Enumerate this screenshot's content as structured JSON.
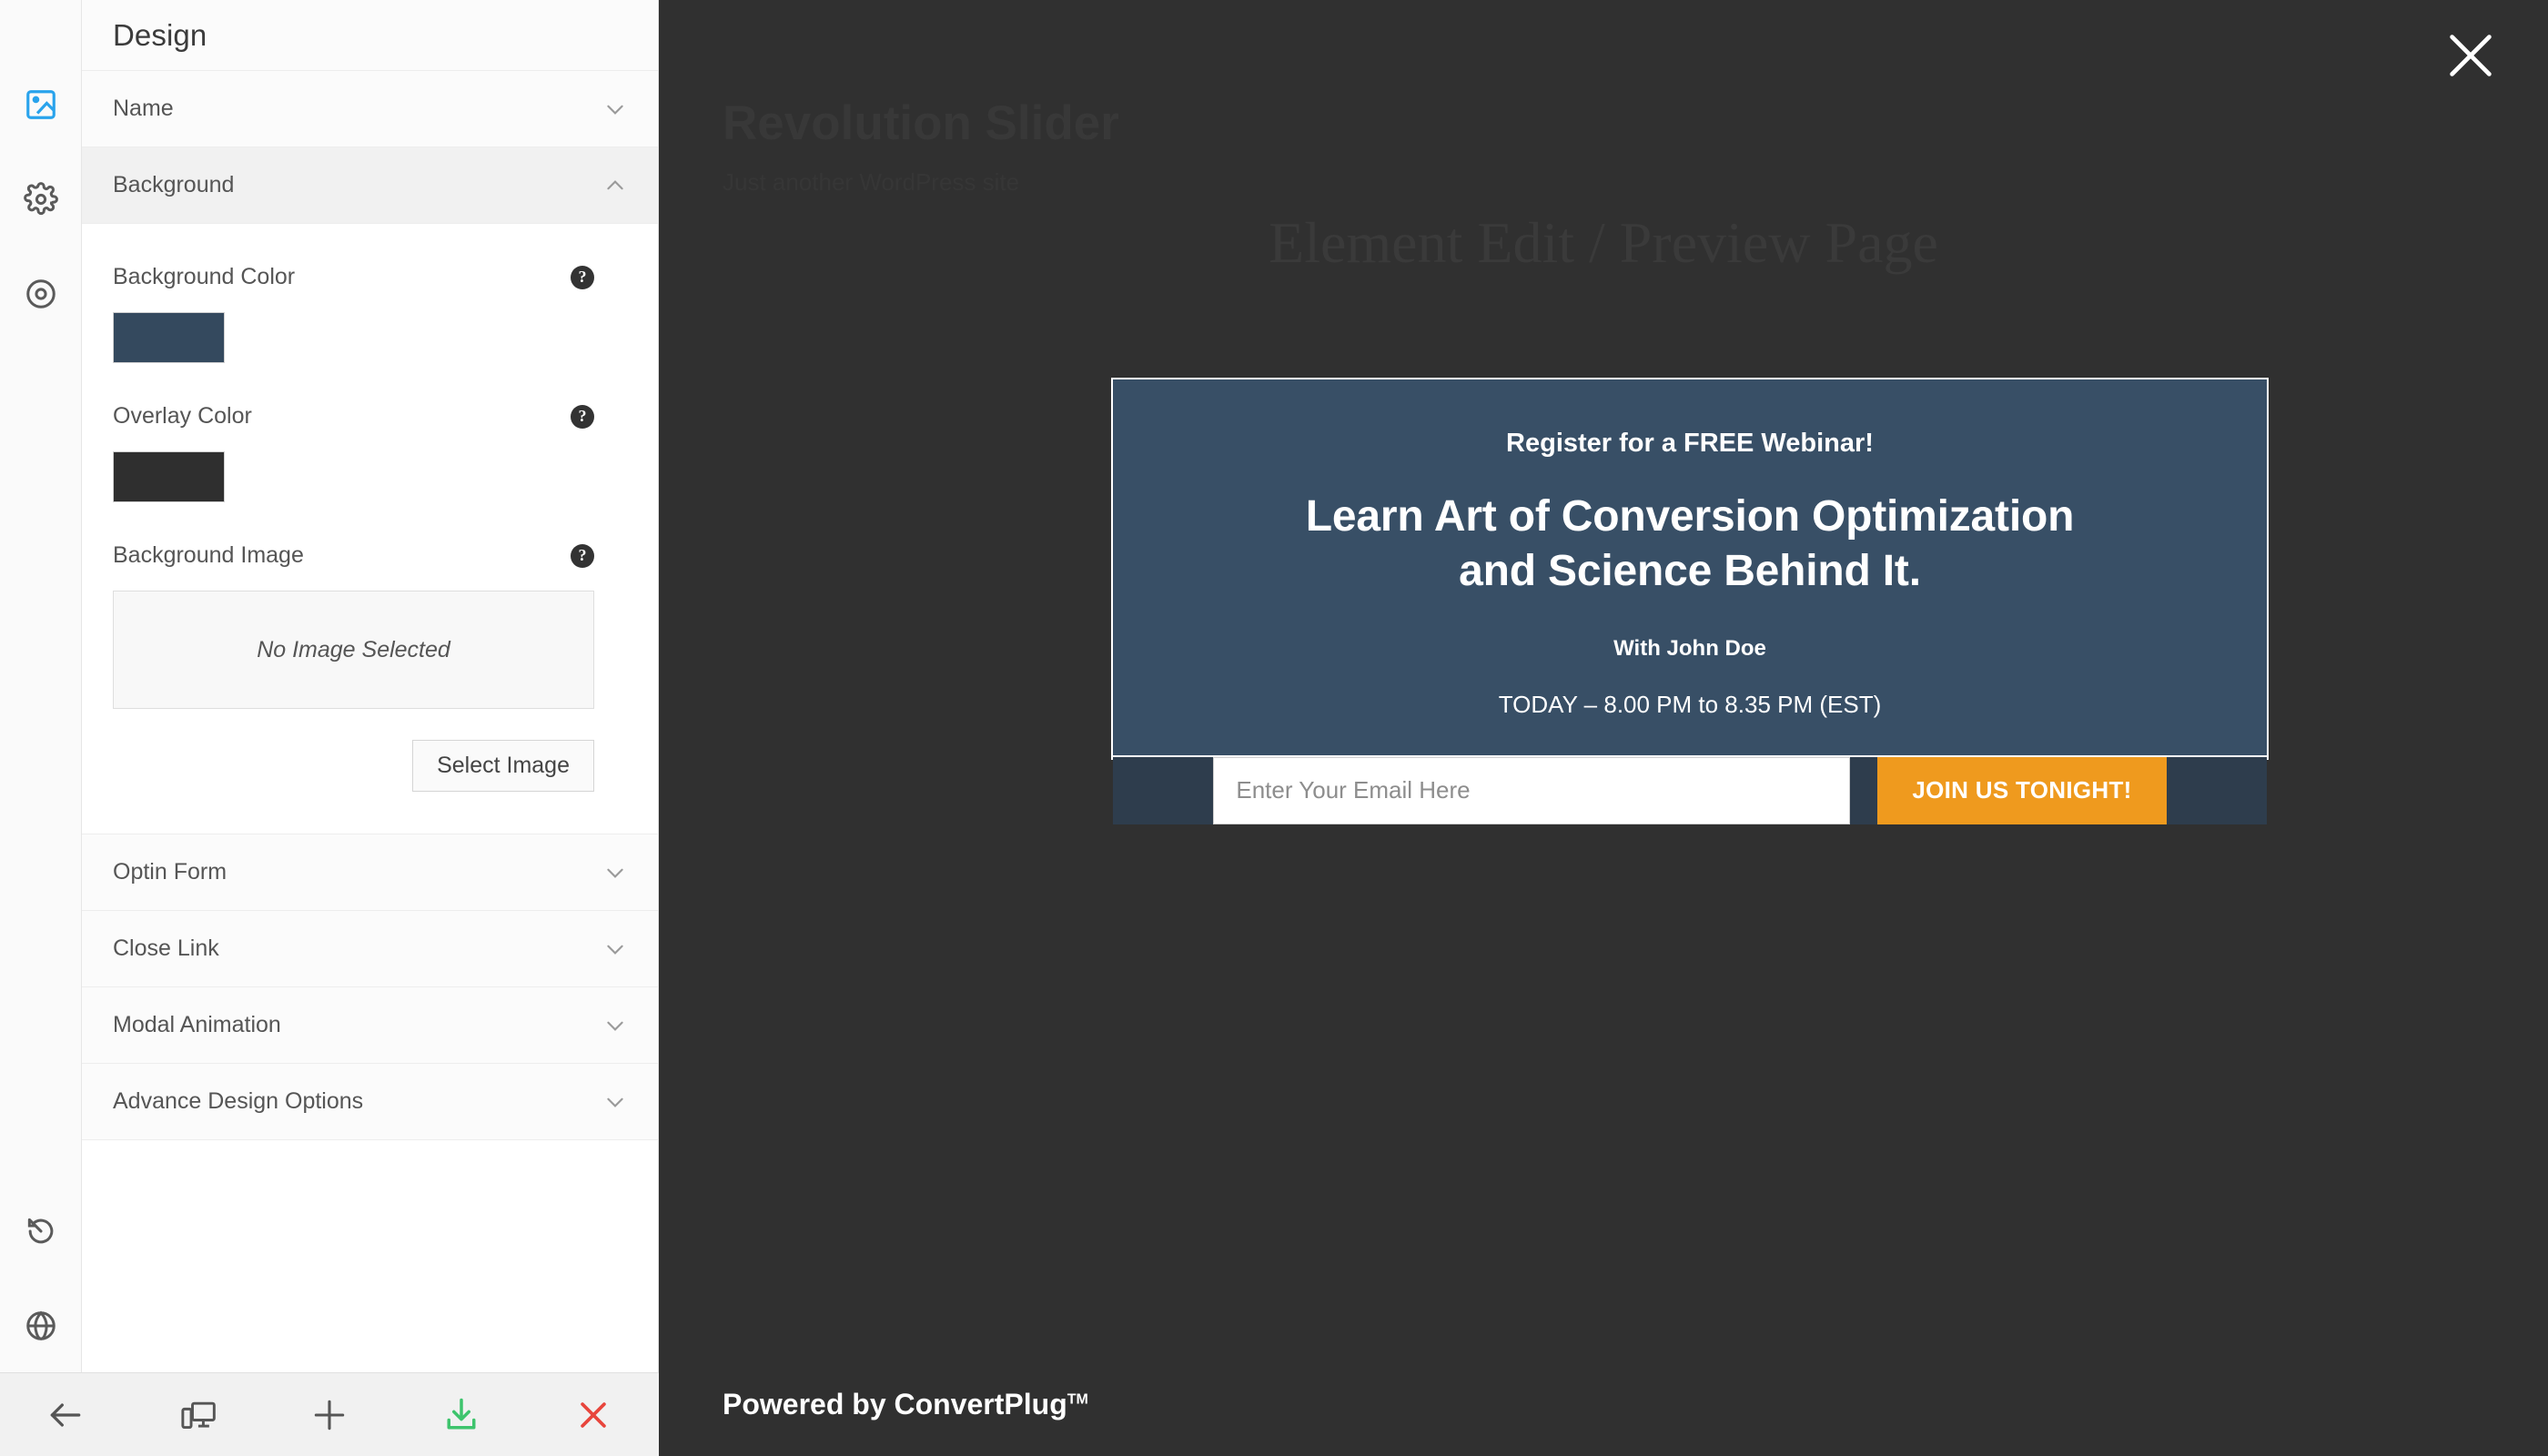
{
  "rail": {
    "top_icons": [
      {
        "name": "design-image-icon",
        "active": true
      },
      {
        "name": "gear-icon",
        "active": false
      },
      {
        "name": "target-icon",
        "active": false
      }
    ],
    "bottom_icons": [
      {
        "name": "revert-history-icon"
      },
      {
        "name": "globe-icon"
      }
    ]
  },
  "panel": {
    "title": "Design",
    "sections": [
      {
        "label": "Name",
        "open": false
      },
      {
        "label": "Background",
        "open": true
      },
      {
        "label": "Optin Form",
        "open": false
      },
      {
        "label": "Close Link",
        "open": false
      },
      {
        "label": "Modal Animation",
        "open": false
      },
      {
        "label": "Advance Design Options",
        "open": false
      }
    ],
    "background": {
      "background_color_label": "Background Color",
      "background_color_value": "#34495e",
      "overlay_color_label": "Overlay Color",
      "overlay_color_value": "#2f2f2f",
      "background_image_label": "Background Image",
      "background_image_placeholder": "No Image Selected",
      "select_image_label": "Select Image",
      "help_glyph": "?"
    }
  },
  "toolbar": {
    "buttons": [
      {
        "name": "back-button",
        "icon": "arrow-left-icon"
      },
      {
        "name": "responsive-preview-button",
        "icon": "devices-icon"
      },
      {
        "name": "add-button",
        "icon": "plus-icon"
      },
      {
        "name": "save-button",
        "icon": "download-save-icon",
        "color": "#3ec46d"
      },
      {
        "name": "close-button",
        "icon": "x-icon",
        "color": "#e8453c"
      }
    ]
  },
  "stage": {
    "site_title": "Revolution Slider",
    "site_tagline": "Just another WordPress site",
    "page_heading": "Element Edit / Preview Page",
    "close_label": "×",
    "powered_by": "Powered by ConvertPlug",
    "powered_by_tm": "TM"
  },
  "modal": {
    "eyebrow": "Register for a FREE Webinar!",
    "headline_line1": "Learn Art of Conversion Optimization",
    "headline_line2": "and Science Behind It.",
    "presenter": "With John Doe",
    "schedule": "TODAY – 8.00 PM to 8.35 PM (EST)",
    "email_placeholder": "Enter Your Email Here",
    "email_value": "",
    "submit_label": "JOIN US TONIGHT!",
    "colors": {
      "body_bg": "#384f66",
      "form_bg": "#2e3d4d",
      "accent": "#ef9a1e",
      "border": "#ffffff"
    }
  }
}
